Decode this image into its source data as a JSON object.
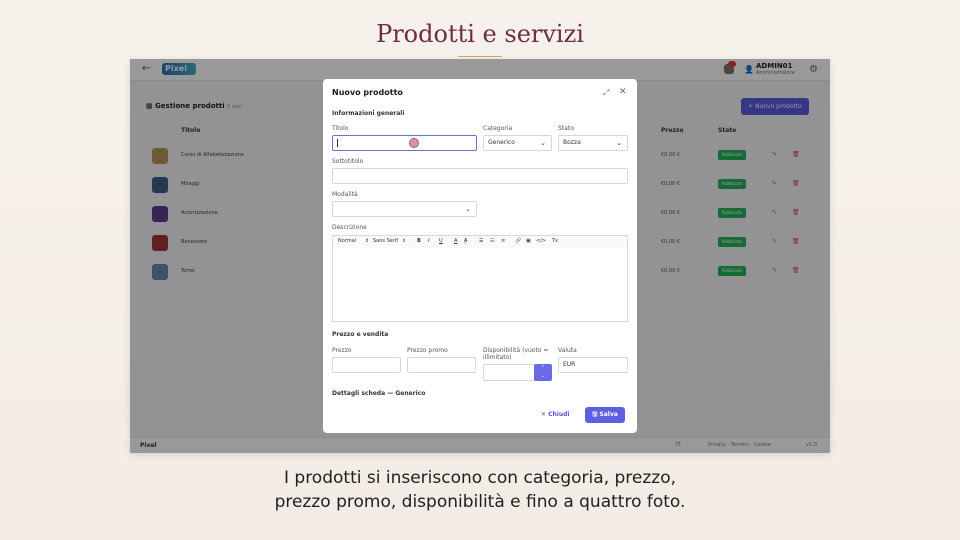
{
  "slide": {
    "title": "Prodotti e servizi",
    "caption_line1": "I prodotti si inseriscono con categoria, prezzo,",
    "caption_line2": "prezzo promo, disponibilità e fino a quattro foto."
  },
  "app": {
    "back_icon": "←",
    "logo": "Pixel",
    "user_name": "ADMIN01",
    "user_role": "Amministratore",
    "page_title": "Gestione prodotti",
    "page_count": "5 voci",
    "new_button": "+ Nuovo prodotto",
    "columns": {
      "title": "Titolo",
      "price": "Prezzo",
      "status": "Stato"
    },
    "rows": [
      {
        "title": "Corso di Alfabetizzazione",
        "price": "€0,00 €",
        "status": "Pubblicato",
        "thumb_color": "#b59a62"
      },
      {
        "title": "Miraggi",
        "price": "€0,00 €",
        "status": "Pubblicato",
        "thumb_color": "#3f5f8a"
      },
      {
        "title": "Autorizzazione",
        "price": "€0,00 €",
        "status": "Pubblicato",
        "thumb_color": "#5a3e8e"
      },
      {
        "title": "Benessere",
        "price": "€0,00 €",
        "status": "Pubblicato",
        "thumb_color": "#a43a3a"
      },
      {
        "title": "Torrei",
        "price": "€0,00 €",
        "status": "Pubblicato",
        "thumb_color": "#6d86b0"
      }
    ],
    "footer": {
      "logo": "Pixel",
      "language": "IT",
      "links": "Privacy · Termini · Cookie",
      "version": "v1.0"
    }
  },
  "modal": {
    "title": "Nuovo prodotto",
    "section_general": "Informazioni generali",
    "label_title": "Titolo",
    "label_category": "Categoria",
    "category_value": "Generico",
    "label_status": "Stato",
    "status_value": "Bozza",
    "label_subtitle": "Sottotitolo",
    "label_mode": "Modalità",
    "label_description": "Descrizione",
    "toolbar": {
      "style": "Normal",
      "font": "Sans Serif",
      "bold": "B",
      "italic": "I",
      "underline": "U",
      "color": "A",
      "highlight": "A",
      "list_bullet": "☰",
      "list_number": "☷",
      "align": "≡",
      "link": "🔗",
      "image": "▣",
      "code": "</>",
      "clear": "Tx"
    },
    "section_price": "Prezzo e vendita",
    "label_price": "Prezzo",
    "label_promo": "Prezzo promo",
    "label_availability": "Disponibilità (vuoto = illimitato)",
    "label_currency": "Valuta",
    "currency_value": "EUR",
    "section_details": "Dettagli scheda — Generico",
    "cancel": "Chiudi",
    "save": "Salva"
  }
}
